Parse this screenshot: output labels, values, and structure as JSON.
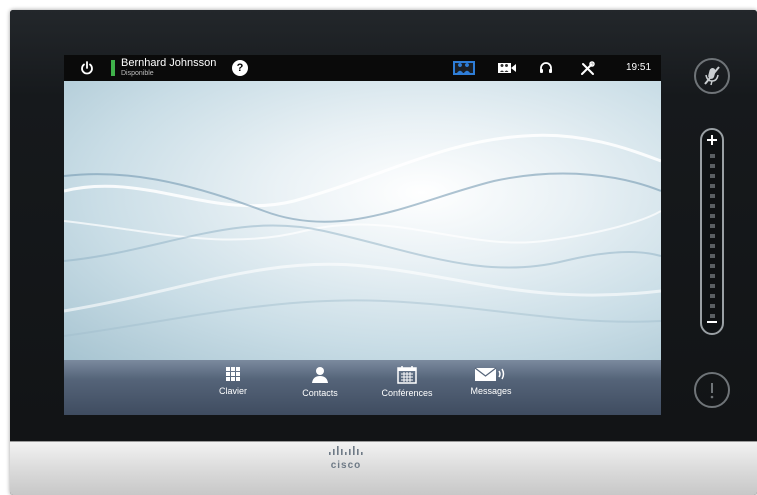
{
  "user": {
    "name": "Bernhard Johnsson",
    "status": "Disponible"
  },
  "help": {
    "label": "?"
  },
  "clock": "19:51",
  "tabs": [
    {
      "label": "Clavier",
      "icon": "keypad-icon"
    },
    {
      "label": "Contacts",
      "icon": "contact-person-icon"
    },
    {
      "label": "Conférences",
      "icon": "calendar-icon"
    },
    {
      "label": "Messages",
      "icon": "envelope-icon"
    }
  ],
  "top_icons": [
    "power-icon",
    "selfview-icon",
    "camera-icon",
    "headset-icon",
    "settings-tools-icon"
  ],
  "side_icons": [
    "mute-microphone-icon",
    "volume-plus-icon",
    "volume-minus-icon",
    "alert-icon"
  ],
  "colors": {
    "presence_available": "#3fb14a",
    "bottom_bar": "#4b596d",
    "top_bar": "#0a0a0a",
    "accent_blue": "#2e7dd7"
  },
  "logo": {
    "text": "cisco"
  }
}
